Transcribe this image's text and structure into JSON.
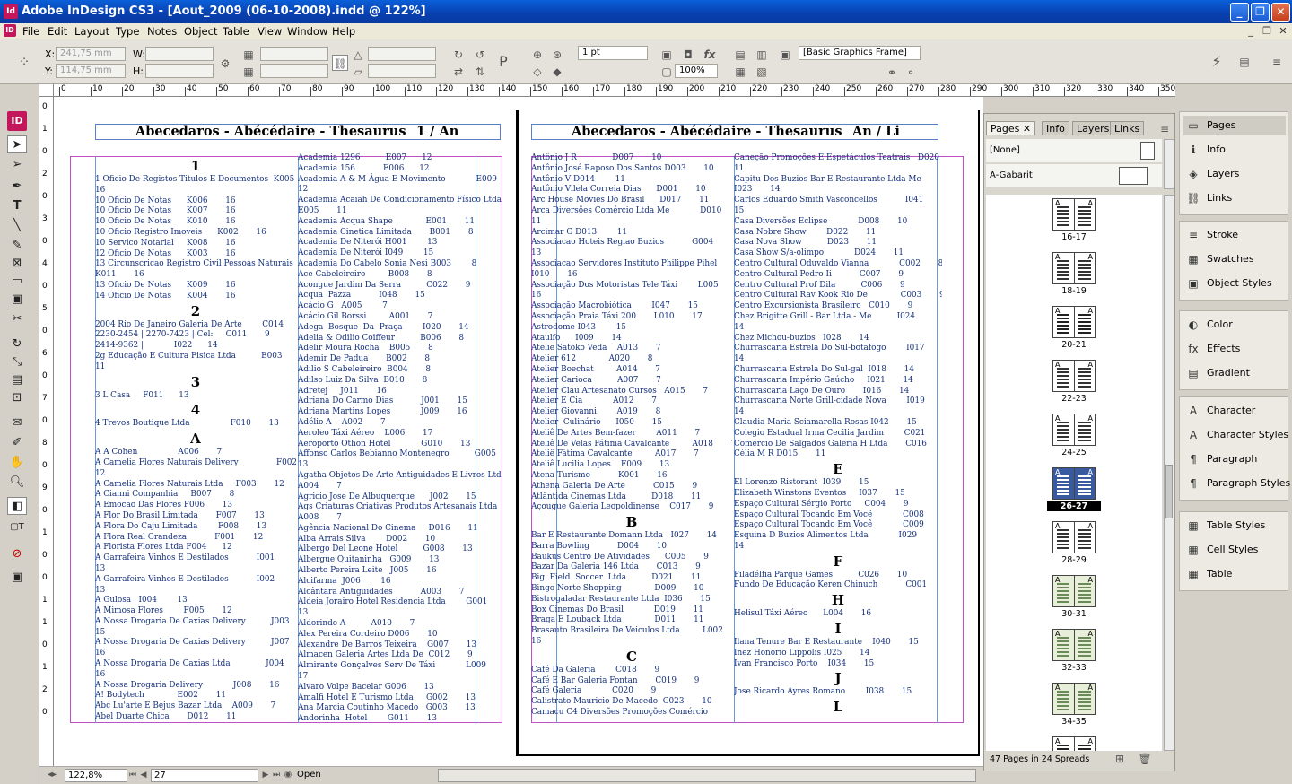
{
  "window": {
    "title": "Adobe InDesign CS3 - [Aout_2009 (06-10-2008).indd @ 122%]",
    "app_icon": "Id"
  },
  "menus": [
    "File",
    "Edit",
    "Layout",
    "Type",
    "Notes",
    "Object",
    "Table",
    "View",
    "Window",
    "Help"
  ],
  "control": {
    "x_label": "X:",
    "y_label": "Y:",
    "w_label": "W:",
    "h_label": "H:",
    "x_value": "241,75 mm",
    "y_value": "114,75 mm",
    "stroke_weight": "1 pt",
    "scale": "100%",
    "frame_style": "[Basic Graphics Frame]"
  },
  "ruler_ticks": [
    "0",
    "10",
    "20",
    "30",
    "40",
    "50",
    "60",
    "70",
    "80",
    "90",
    "100",
    "110",
    "120",
    "130",
    "140",
    "150",
    "160",
    "170",
    "180",
    "190",
    "200",
    "210",
    "220",
    "230",
    "240",
    "250",
    "260",
    "270",
    "280",
    "290",
    "300",
    "310",
    "320",
    "330",
    "340",
    "350"
  ],
  "ruler_v_ticks": [
    "0",
    "1",
    "0",
    "2",
    "0",
    "3",
    "0",
    "4",
    "0",
    "5",
    "0",
    "6",
    "0",
    "7",
    "0",
    "8",
    "0",
    "9",
    "0",
    "1",
    "0",
    "0",
    "1",
    "1",
    "0",
    "1",
    "2",
    "0"
  ],
  "page_left": {
    "header": "Abecedaros - Abécédaire - Thesaurus",
    "header_right": "1  / An",
    "col1": [
      {
        "t": "letter",
        "v": "1"
      },
      {
        "t": "text",
        "v": "1 Oficio De Registos Titulos E Documentos  K005\n16\n10 Oficio De Notas      K006       16\n10 Oficio De Notas      K007       16\n10 Oficio De Notas      K010       16\n10 Oficio Registro Imoveis      K002       16\n10 Servico Notarial     K008       16\n12 Oficio De Notas      K003       16\n13 Circunscricao Registro Civil Pessoas Naturais\nK011       16\n13 Oficio De Notas      K009       16\n14 Oficio De Notas      K004       16"
      },
      {
        "t": "letter",
        "v": "2"
      },
      {
        "t": "text",
        "v": "2004 Rio De Janeiro Galeria De Arte        C014       9\n2230-2454 | 2270-7423 | Cel:     C011       9\n2414-9362 |            I022      14\n2g Educação E Cultura Fisica Ltda          E003\n11"
      },
      {
        "t": "letter",
        "v": "3"
      },
      {
        "t": "text",
        "v": "3 L Casa     F011      13"
      },
      {
        "t": "letter",
        "v": "4"
      },
      {
        "t": "text",
        "v": "4 Trevos Boutique Ltda                F010       13"
      },
      {
        "t": "letter",
        "v": "A"
      },
      {
        "t": "text",
        "v": "A A Cohen                A006       7\nA Camelia Flores Naturais Delivery               F002\n12\nA Camelia Flores Naturais Ltda     F003       12\nA Cianni Companhia     B007       8\nA Emocao Das Flores F006       13\nA Flor Do Brasil Limitada       F007       13\nA Flora Do Caju Limitada        F008       13\nA Flora Real Grandeza           F001       12\nA Florista Flores Ltda F004      12\nA Garrafeira Vinhos E Destilados           I001\n13\nA Garrafeira Vinhos E Destilados           I002\n13\nA Gulosa   I004        13\nA Mimosa Flores        F005       12\nA Nossa Drogaria De Caxias Delivery          J003\n15\nA Nossa Drogaria De Caxias Delivery          J007\n16\nA Nossa Drogaria De Caxias Ltda              J004\n16\nA Nossa Drogaria Delivery            J008       16\nA! Bodytech             E002       11\nAbc Lu'arte E Bejus Bazar Ltda    A009       7\nAbel Duarte Chica       D012       11"
      }
    ],
    "col2": "Academia 1296          E007      12\nAcademia 156           E006      12\nAcademia A & M Água E Movimento            E009\n12\nAcademia Acaiah De Condicionamento Físico Ltda\nE005       11\nAcademia Acqua Shape             E001       11\nAcademia Cinetica Limitada       B001       8\nAcademia De Niterói H001        13\nAcademia De Niterói I049        15\nAcademia Do Cabelo Sonia Nesi B003        8\nAce Cabeleireiro         B008       8\nAcongue Jardim Da Serra          C022       9\nAcqua  Pazza           I048       15\nAcácio G   A005        7\nAcácio Gil Borssi         A001       7\nAdega  Bosque  Da  Praça        I020       14\nAdelia & Odilio Coiffeur          B006       8\nAdelir Moura Rocha    B005       8\nAdemir De Padua       B002       8\nAdilio S Cabeleireiro  B004       8\nAdilso Luiz Da Silva  B010       8\nAdretej     J011       16\nAdriana Do Carmo Dias           J001       15\nAdriana Martins Lopes            J009       16\nAdélio A    A002       7\nAeroleo Táxi Aéreo    L006       17\nAeroporto Othon Hotel            G010       13\nAffonso Carlos Bebianno Montenegro          G005\n13\nAgatha Objetos De Arte Antiguidades E Livros Ltda\nA004       7\nAgricio Jose De Albuquerque      J002       15\nAgs Criaturas Criativas Produtos Artesanais Ltda\nA008       7\nAgência Nacional Do Cinema     D016       11\nAlba Arrais Silva        D002       10\nAlbergo Del Leone Hotel          G008       13\nAlbergue Quitaninha   G009       13\nAlberto Pereira Leite   J005       16\nAlcifarma  J006        16\nAlcântara Antiguidades           A003       7\nAldeia Jorairo Hotel Residencia Ltda        G001\n13\nAldorindo A          A010       7\nAlex Pereira Cordeiro D006       10\nAlexandre De Barros Teixeira    G007       13\nAlmacen Galeria Artes Ltda De  C012       9\nAlmirante Gonçalves Serv De Táxi            L009\n17\nAlvaro Volpe Bacelar G006       13\nAmalfi Hotel E Turismo Ltda     G002       13\nAna Marcia Coutinho Macedo   G003       13\nAndorinha  Hotel        G011       13"
  },
  "page_right": {
    "header": "Abecedaros - Abécédaire - Thesaurus",
    "header_right": "An / Li",
    "col1": [
      {
        "t": "text",
        "v": "Antônio J R              D007       10\nAntônio José Raposo Dos Santos D003       10\nAntônio V D014        11\nAntônio Vilela Correia Dias      D001       10\nArc House Movies Do Brasil      D017       11\nArca Diversões Comércio Ltda Me            D010\n11\nArcimar G D013        11\nAssociacao Hoteis Regiao Buzios           G004\n13\nAssociacao Servidores Instituto Philippe Pihel\nI010       16\nAssociação Dos Motoristas Tele Táxi        L005\n16\nAssociação Macrobiótica        I047       15\nAssociação Praia Táxi 200       L010       17\nAstrodome I043        15\nAtaulfo      I009       14\nAtelie Satoko Veda    A013       7\nAtelier 612             A020       8\nAtelier Boechat         A014       7\nAtelier Carioca          A007       7\nAtelier Clau Artesanato Cursos   A015       7\nAtelier E Cia            A012       7\nAtelier Giovanni        A019       8\nAtelier  Culinário      I050       15\nAteliê De Artes Bem-fazer        A011       7\nAteliê De Velas Fátima Cavalcante         A018       7\nAteliê Fátima Cavalcante         A017       7\nAteliê Lucilia Lopes    F009       13\nAtena Turismo           K001       16\nAthena Galeria De Arte           C015       9\nAtlântida Cinemas Ltda          D018       11\nAçougue Galeria Leopoldinense    C017       9"
      },
      {
        "t": "letter",
        "v": "B"
      },
      {
        "t": "text",
        "v": "Bar E Restaurante Domann Ltda   I027       14\nBarra Bowling           D004       10\nBaukus Centro De Atividades      C005       9\nBazar Da Galeria 146 Ltda       C013       9\nBig  Field  Soccer  Ltda          D021       11\nBingo Norte Shopping             D009       10\nBistrogaladar Restaurante Ltda  I036       15\nBox Cinemas Do Brasil            D019       11\nBraga E Louback Ltda             D011       11\nBrasauto Brasileira De Veiculos Ltda         L002\n16"
      },
      {
        "t": "letter",
        "v": "C"
      },
      {
        "t": "text",
        "v": "Café Da Galeria        C018       9\nCafé E Bar Galeria Fontan       C019       9\nCafé Galeria            C020       9\nCalistrato Mauricio De Macedo  C023       10\nCamacu C4 Diversões Promoções Comércio"
      }
    ],
    "col2": [
      {
        "t": "text",
        "v": "Caneção Promoções E Espetáculos Teatrais   D020\n11\nCapitu Dos Buzios Bar E Restaurante Ltda Me\nI023       14\nCarlos Eduardo Smith Vasconcellos           I041\n15\nCasa Diversões Eclipse            D008       10\nCasa Nobre Show        D022       11\nCasa Nova Show          D023       11\nCasa Show S/a-olimpo            D024       11\nCentro Cultural Oduvaldo Vianna            C002       8\nCentro Cultural Pedro Ii           C007       9\nCentro Cultural Prof Dila          C006       9\nCentro Cultural Rav Kook Rio De             C003       9\nCentro Excursionista Brasileiro   C010       9\nChez Brigitte Grill - Bar Ltda - Me          I024\n14\nChez Michou-buzios   I028       14\nChurrascaria Estrela Do Sul-botafogo        I017\n14\nChurrascaria Estrela Do Sul-gal  I018       14\nChurrascaria Império Gaúcho     I021       14\nChurrascaria Laço De Ouro       I016       14\nChurrascaria Norte Grill-cidade Nova        I019\n14\nClaudia Maria Sciamarella Rosas I042       15\nColegio Estadual Irma Cecilia Jardim        C021       9\nComércio De Salgados Galeria H Ltda       C016       9\nCélia M R D015       11"
      },
      {
        "t": "letter",
        "v": "E"
      },
      {
        "t": "text",
        "v": "El Lorenzo Ristorant  I039       15\nElizabeth Winstons Eventos     I037       15\nEspaço Cultural Sérgio Porto     C004       9\nEspaço Cultural Tocando Em Você            C008       9\nEspaço Cultural Tocando Em Você            C009       9\nEsquina D Buzios Alimentos Ltda            I029\n14"
      },
      {
        "t": "letter",
        "v": "F"
      },
      {
        "t": "text",
        "v": "Filadélfia Parque Games          C026       10\nFundo De Educação Keren Chinuch           C001       8"
      },
      {
        "t": "letter",
        "v": "H"
      },
      {
        "t": "text",
        "v": "Helisul Táxi Aéreo      L004       16"
      },
      {
        "t": "letter",
        "v": "I"
      },
      {
        "t": "text",
        "v": "Ilana Tenure Bar E Restaurante    I040       15\nInez Honorio Lippolis I025       14\nIvan Francisco Porto    I034       15"
      },
      {
        "t": "letter",
        "v": "J"
      },
      {
        "t": "text",
        "v": "Jose Ricardo Ayres Romano        I038       15"
      },
      {
        "t": "letter",
        "v": "L"
      }
    ]
  },
  "status": {
    "zoom": "122,8%",
    "page": "27",
    "state": "Open"
  },
  "pages_panel": {
    "tabs": [
      "Pages",
      "Info",
      "Layers",
      "Links"
    ],
    "masters": [
      {
        "label": "[None]"
      },
      {
        "label": "A-Gabarit"
      }
    ],
    "spreads": [
      {
        "label": "16-17",
        "style": "mixed"
      },
      {
        "label": "18-19",
        "style": "text"
      },
      {
        "label": "20-21",
        "style": "dark"
      },
      {
        "label": "22-23",
        "style": "text"
      },
      {
        "label": "24-25",
        "style": "text"
      },
      {
        "label": "26-27",
        "style": "selected"
      },
      {
        "label": "28-29",
        "style": "text"
      },
      {
        "label": "30-31",
        "style": "map"
      },
      {
        "label": "32-33",
        "style": "map"
      },
      {
        "label": "34-35",
        "style": "map"
      },
      {
        "label": "",
        "style": "dark"
      }
    ],
    "footer": "47 Pages in 24 Spreads"
  },
  "dock": {
    "groups": [
      [
        {
          "label": "Pages",
          "icon": "pages-icon",
          "glyph": "▭",
          "active": true
        },
        {
          "label": "Info",
          "icon": "info-icon",
          "glyph": "ℹ"
        },
        {
          "label": "Layers",
          "icon": "layers-icon",
          "glyph": "◈"
        },
        {
          "label": "Links",
          "icon": "links-icon",
          "glyph": "⛓"
        }
      ],
      [
        {
          "label": "Stroke",
          "icon": "stroke-icon",
          "glyph": "≡"
        },
        {
          "label": "Swatches",
          "icon": "swatches-icon",
          "glyph": "▦"
        },
        {
          "label": "Object Styles",
          "icon": "object-styles-icon",
          "glyph": "▣"
        }
      ],
      [
        {
          "label": "Color",
          "icon": "color-icon",
          "glyph": "◐"
        },
        {
          "label": "Effects",
          "icon": "effects-icon",
          "glyph": "fx"
        },
        {
          "label": "Gradient",
          "icon": "gradient-icon",
          "glyph": "▤"
        }
      ],
      [
        {
          "label": "Character",
          "icon": "character-icon",
          "glyph": "A"
        },
        {
          "label": "Character Styles",
          "icon": "character-styles-icon",
          "glyph": "A"
        },
        {
          "label": "Paragraph",
          "icon": "paragraph-icon",
          "glyph": "¶"
        },
        {
          "label": "Paragraph Styles",
          "icon": "paragraph-styles-icon",
          "glyph": "¶"
        }
      ],
      [
        {
          "label": "Table Styles",
          "icon": "table-styles-icon",
          "glyph": "▦"
        },
        {
          "label": "Cell Styles",
          "icon": "cell-styles-icon",
          "glyph": "▦"
        },
        {
          "label": "Table",
          "icon": "table-icon",
          "glyph": "▦"
        }
      ]
    ]
  }
}
